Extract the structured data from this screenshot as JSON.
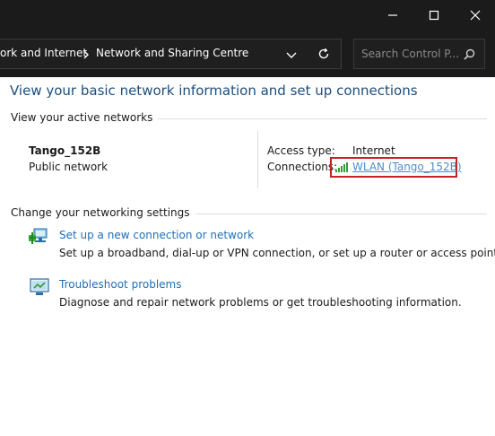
{
  "window": {
    "minimize_icon": "minimize-icon",
    "maximize_icon": "maximize-icon",
    "close_icon": "close-icon"
  },
  "address_bar": {
    "breadcrumb": [
      "ork and Internet",
      "Network and Sharing Centre"
    ],
    "search_placeholder": "Search Control P..."
  },
  "main": {
    "heading": "View your basic network information and set up connections",
    "active_networks": {
      "label": "View your active networks",
      "network_name": "Tango_152B",
      "network_type": "Public network",
      "access_type_label": "Access type:",
      "access_type_value": "Internet",
      "connections_label": "Connections:",
      "connection_link": "WLAN (Tango_152B)"
    },
    "settings": {
      "label": "Change your networking settings",
      "items": [
        {
          "title": "Set up a new connection or network",
          "description": "Set up a broadband, dial-up or VPN connection, or set up a router or access point.",
          "icon": "network-setup-icon"
        },
        {
          "title": "Troubleshoot problems",
          "description": "Diagnose and repair network problems or get troubleshooting information.",
          "icon": "troubleshoot-icon"
        }
      ]
    }
  },
  "colors": {
    "titlebar": "#1b1b1b",
    "heading": "#1e4e79",
    "link": "#1e6fb5",
    "highlight": "#c62128"
  }
}
